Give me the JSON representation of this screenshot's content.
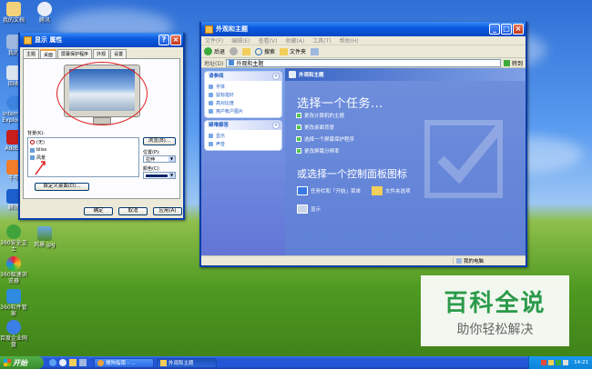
{
  "desktop": {
    "icons": [
      {
        "label": "我的文档"
      },
      {
        "label": "腾讯"
      },
      {
        "label": "我的"
      },
      {
        "label": "回收"
      },
      {
        "label": "Internet Explorer"
      },
      {
        "label": "Adobe"
      },
      {
        "label": "千牛"
      },
      {
        "label": "腾讯"
      },
      {
        "label": "360安全卫士"
      },
      {
        "label": "风景.jpg"
      },
      {
        "label": "360极速浏览器"
      },
      {
        "label": "360软件管家"
      },
      {
        "label": "百度企业网盘"
      }
    ]
  },
  "display_props": {
    "title": "显示 属性",
    "tabs": [
      "主题",
      "桌面",
      "屏幕保护程序",
      "外观",
      "设置"
    ],
    "background_label": "背景(K):",
    "bg_items": [
      "(无)",
      "bliss",
      "风景"
    ],
    "browse": "浏览(B)...",
    "position_label": "位置(P):",
    "position_value": "拉伸",
    "color_label": "颜色(C):",
    "customize": "自定义桌面(D)...",
    "ok": "确定",
    "cancel": "取消",
    "apply": "应用(A)"
  },
  "explorer": {
    "title": "外观和主题",
    "menu": [
      "文件(F)",
      "编辑(E)",
      "查看(V)",
      "收藏(A)",
      "工具(T)",
      "帮助(H)"
    ],
    "back": "后退",
    "search": "搜索",
    "folders": "文件夹",
    "address_label": "地址(D)",
    "address_value": "外观和主题",
    "go": "转到",
    "see_also": {
      "title": "请参阅",
      "items": [
        "字体",
        "鼠标指针",
        "高对比度",
        "用户帐户图片"
      ]
    },
    "troubleshoot": {
      "title": "疑难解答",
      "items": [
        "显示",
        "声音"
      ]
    },
    "header": "外观和主题",
    "pick_task": "选择一个任务...",
    "tasks": [
      "更改计算机的主题",
      "更改桌面背景",
      "选择一个屏幕保护程序",
      "更改屏幕分辨率"
    ],
    "pick_icon": "或选择一个控制面板图标",
    "cp_icons": [
      "任务栏和「开始」菜单",
      "文件夹选项",
      "显示"
    ],
    "status": "我的电脑"
  },
  "watermark": {
    "line1": "百科全说",
    "line2": "助你轻松解决"
  },
  "taskbar": {
    "start": "开始",
    "buttons": [
      "搜狗指南 - ...",
      "外观和主题"
    ],
    "clock": "14:21"
  }
}
